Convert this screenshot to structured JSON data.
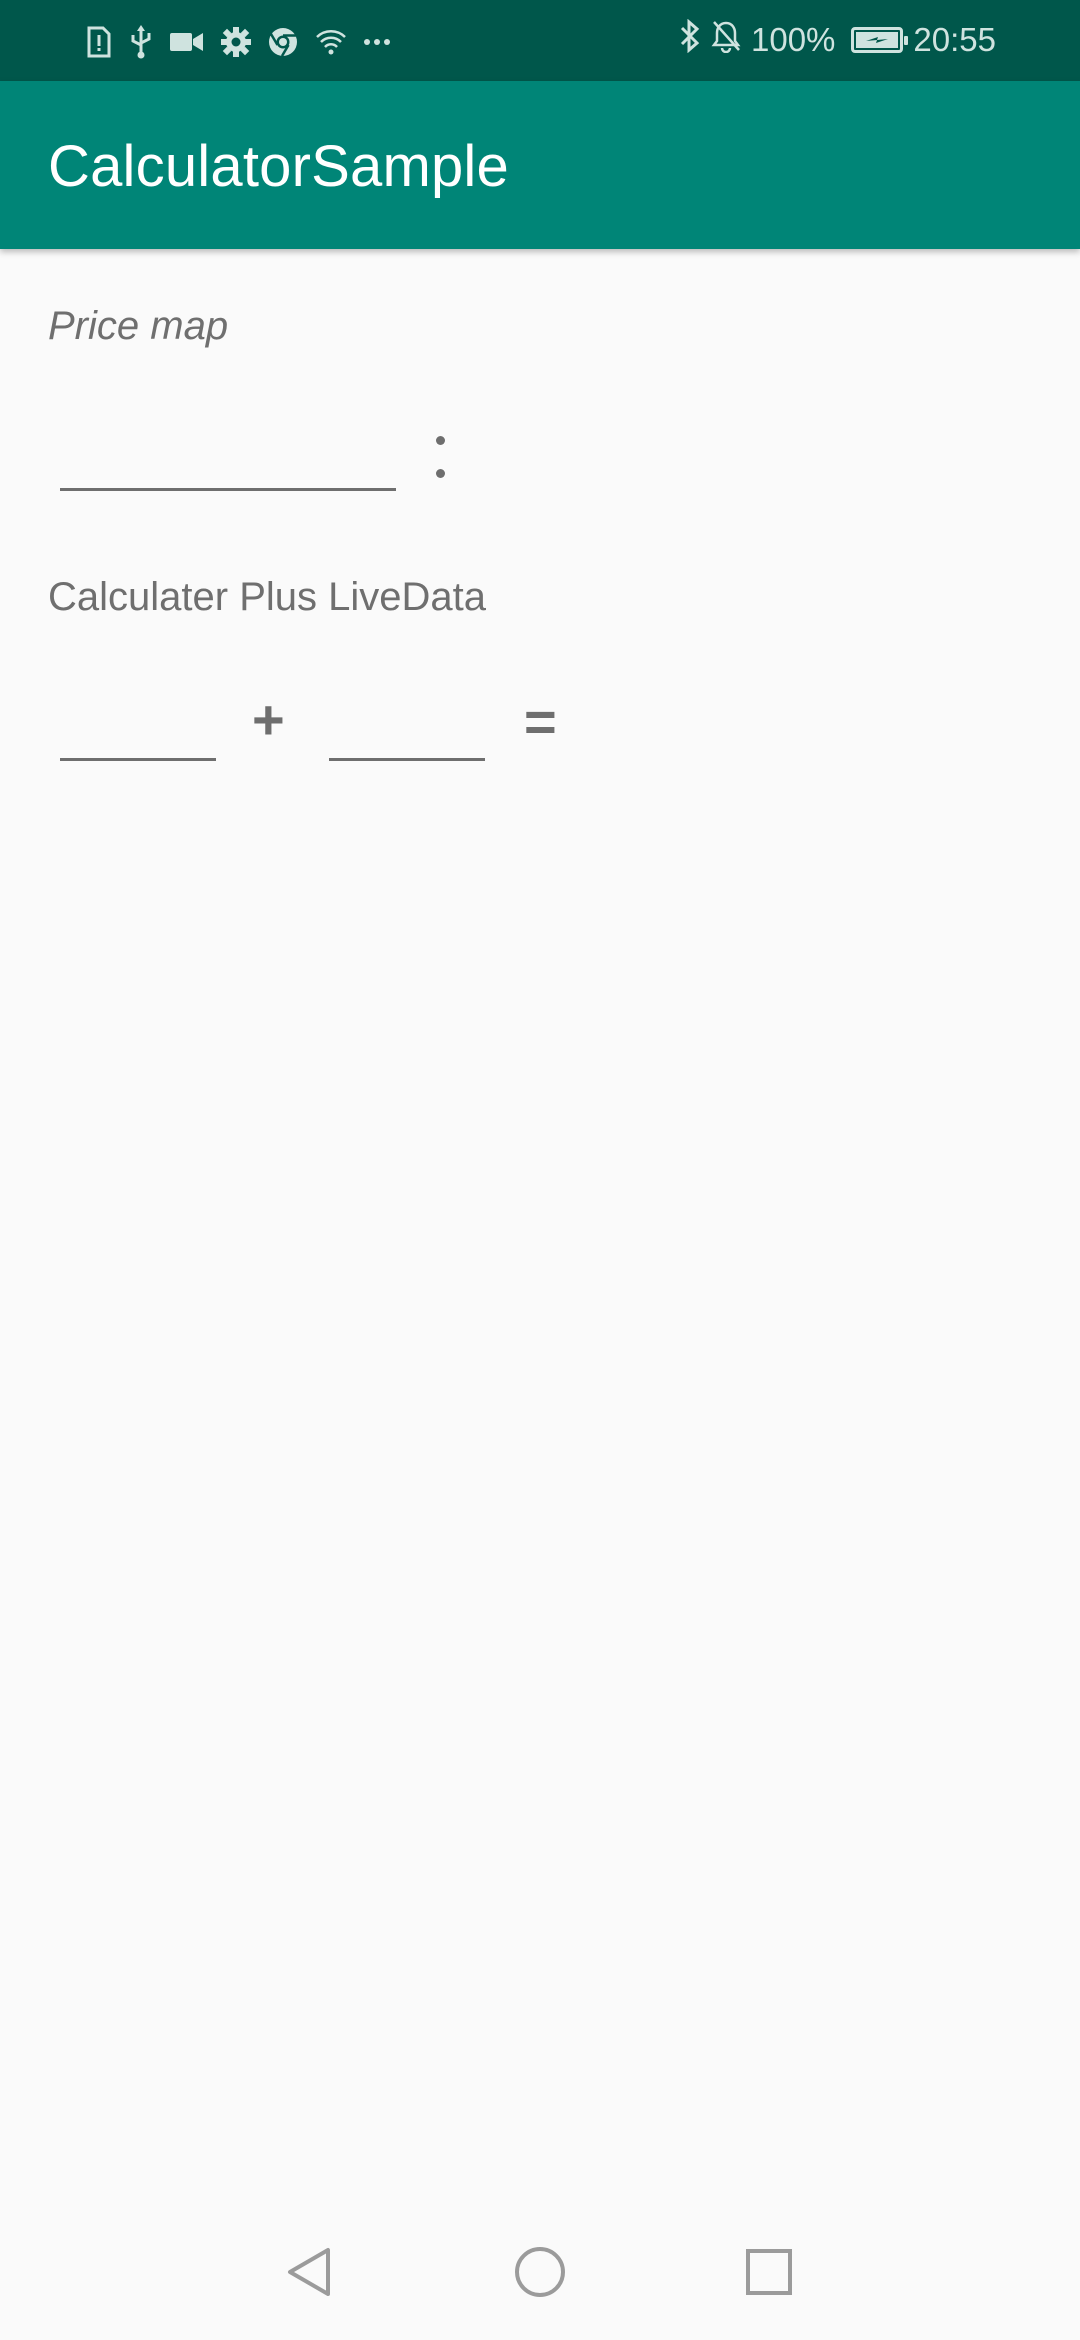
{
  "status_bar": {
    "battery_percent": "100%",
    "battery_level": 1.0,
    "time": "20:55",
    "left_icons": [
      "sim-alert-icon",
      "usb-icon",
      "video-camera-icon",
      "settings-icon",
      "chrome-icon",
      "wifi-question-icon",
      "more-dots-icon"
    ],
    "right_icons": [
      "bluetooth-icon",
      "notifications-off-icon",
      "battery-charging-icon"
    ]
  },
  "app_bar": {
    "title": "CalculatorSample"
  },
  "price_map": {
    "label": "Price map",
    "input_value": "",
    "separator_icon": "colon-icon"
  },
  "livedata": {
    "label": "Calculater Plus LiveData",
    "first_value": "",
    "plus": "+",
    "second_value": "",
    "equals": "="
  },
  "nav_bar": {
    "buttons": [
      "back-icon",
      "home-icon",
      "recents-icon"
    ]
  },
  "colors": {
    "status_bar": "#00574b",
    "app_bar": "#008577",
    "background": "#fafafa",
    "text_secondary": "#6f6f6f"
  }
}
